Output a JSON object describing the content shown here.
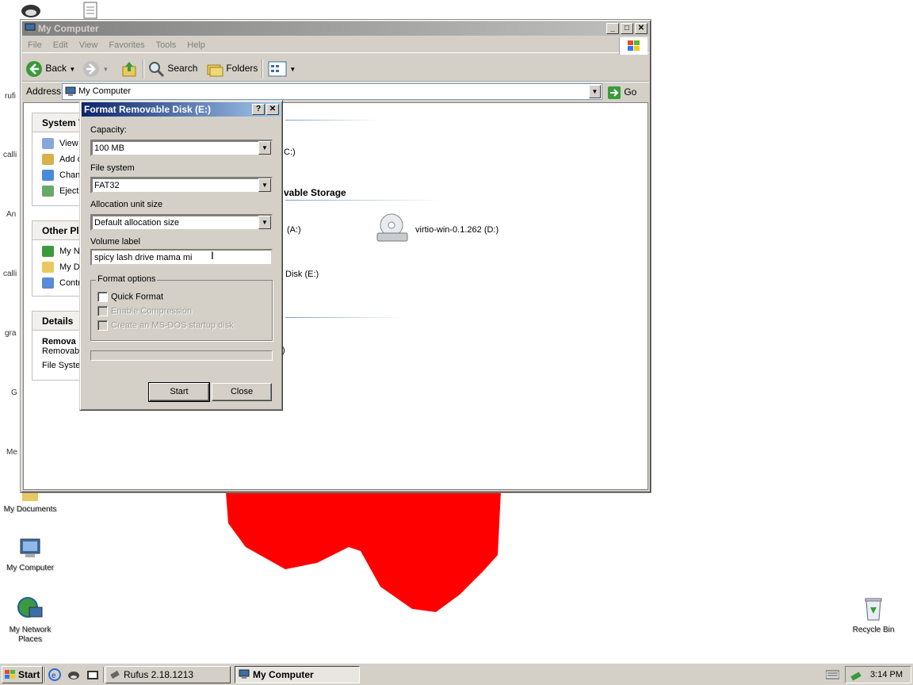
{
  "desktop": {
    "icons": [
      {
        "label": "My Documents"
      },
      {
        "label": "My Computer"
      },
      {
        "label": "My Network Places"
      },
      {
        "label": "Recycle Bin"
      }
    ],
    "stubs": [
      "rufi",
      "calli",
      "An",
      "calli",
      "gra",
      "G",
      "Me"
    ]
  },
  "explorer": {
    "title": "My Computer",
    "menu": [
      "File",
      "Edit",
      "View",
      "Favorites",
      "Tools",
      "Help"
    ],
    "toolbar": {
      "back": "Back",
      "search": "Search",
      "folders": "Folders"
    },
    "address": {
      "label": "Address",
      "value": "My Computer",
      "go": "Go"
    },
    "tasks": {
      "header": "System T",
      "items": [
        "View s",
        "Add o",
        "Chang",
        "Eject"
      ]
    },
    "other_places": {
      "header": "Other Pla",
      "items": [
        "My Ne",
        "My Do",
        "Contr"
      ]
    },
    "details": {
      "header": "Details",
      "name": "Remova",
      "type": "Removable",
      "fs": "File Syster"
    },
    "content": {
      "c_drive_suffix": "C:)",
      "removable_header": "vable Storage",
      "a_drive_suffix": "(A:)",
      "cd_drive": "virtio-win-0.1.262 (D:)",
      "e_drive_suffix": "Disk (E:)",
      "e_drive_extra": ")"
    }
  },
  "format_dialog": {
    "title": "Format Removable Disk (E:)",
    "capacity_label": "Capacity:",
    "capacity_value": "100 MB",
    "fs_label": "File system",
    "fs_value": "FAT32",
    "alloc_label": "Allocation unit size",
    "alloc_value": "Default allocation size",
    "volume_label": "Volume label",
    "volume_value": "spicy lash drive mama mi",
    "options_title": "Format options",
    "quick_format": "Quick Format",
    "enable_compression": "Enable Compression",
    "msdos_disk": "Create an MS-DOS startup disk",
    "start": "Start",
    "close": "Close"
  },
  "taskbar": {
    "start": "Start",
    "tasks": [
      {
        "label": "Rufus 2.18.1213",
        "active": false
      },
      {
        "label": "My Computer",
        "active": true
      }
    ],
    "clock": "3:14 PM"
  },
  "colors": {
    "heart": "#ff0000",
    "dialog_title": "#0a246a",
    "inactive_title": "#808080"
  }
}
